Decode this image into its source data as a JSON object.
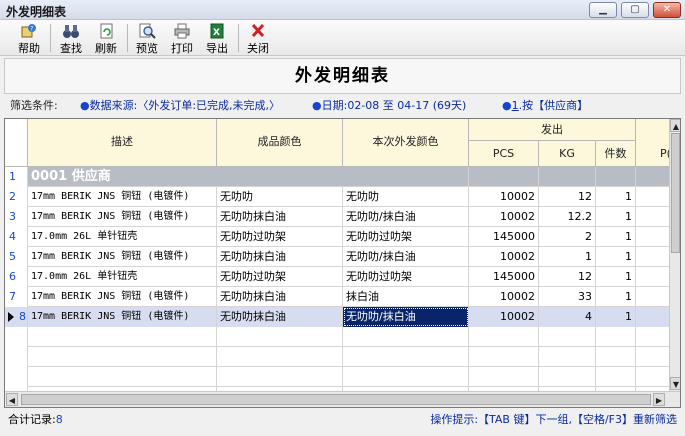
{
  "window": {
    "title": "外发明细表"
  },
  "toolbar": [
    {
      "label": "帮助",
      "icon": "help-icon"
    },
    {
      "label": "查找",
      "icon": "binoculars-icon"
    },
    {
      "label": "刷新",
      "icon": "refresh-icon"
    },
    {
      "label": "预览",
      "icon": "magnifier-icon"
    },
    {
      "label": "打印",
      "icon": "printer-icon"
    },
    {
      "label": "导出",
      "icon": "excel-export-icon"
    },
    {
      "label": "关闭",
      "icon": "close-x-icon"
    }
  ],
  "report": {
    "title": "外发明细表"
  },
  "filter": {
    "label": "筛选条件:",
    "source": "数据来源:〈外发订单:已完成,未完成,〉",
    "date": "日期:02-08 至 04-17 (69天)",
    "group_num": "1",
    "group_text": ".按【供应商】"
  },
  "table": {
    "headers": {
      "desc": "描述",
      "color": "成品颜色",
      "out_color": "本次外发颜色",
      "issued": "发出",
      "pcs": "PCS",
      "kg": "KG",
      "pieces": "件数",
      "extra": "P("
    },
    "group": {
      "rn": "1",
      "text": "0001  供应商"
    },
    "rows": [
      {
        "rn": "2",
        "desc": "17mm BERIK JNS 铜钮 (电镀件)",
        "color": "无叻叻",
        "out_color": "无叻叻",
        "pcs": "10002",
        "kg": "12",
        "pieces": "1"
      },
      {
        "rn": "3",
        "desc": "17mm BERIK JNS 铜钮 (电镀件)",
        "color": "无叻叻抹白油",
        "out_color": "无叻叻/抹白油",
        "pcs": "10002",
        "kg": "12.2",
        "pieces": "1"
      },
      {
        "rn": "4",
        "desc": "17.0mm 26L 单针钮壳",
        "color": "无叻叻过叻架",
        "out_color": "无叻叻过叻架",
        "pcs": "145000",
        "kg": "2",
        "pieces": "1"
      },
      {
        "rn": "5",
        "desc": "17mm BERIK JNS 铜钮 (电镀件)",
        "color": "无叻叻抹白油",
        "out_color": "无叻叻/抹白油",
        "pcs": "10002",
        "kg": "1",
        "pieces": "1"
      },
      {
        "rn": "6",
        "desc": "17.0mm 26L 单针钮壳",
        "color": "无叻叻过叻架",
        "out_color": "无叻叻过叻架",
        "pcs": "145000",
        "kg": "12",
        "pieces": "1"
      },
      {
        "rn": "7",
        "desc": "17mm BERIK JNS 铜钮 (电镀件)",
        "color": "无叻叻抹白油",
        "out_color": "抹白油",
        "pcs": "10002",
        "kg": "33",
        "pieces": "1"
      },
      {
        "rn": "8",
        "desc": "17mm BERIK JNS 铜钮 (电镀件)",
        "color": "无叻叻抹白油",
        "out_color": "无叻叻/抹白油",
        "pcs": "10002",
        "kg": "4",
        "pieces": "1"
      }
    ]
  },
  "status": {
    "count_label": "合计记录:",
    "count": "8",
    "hint": "操作提示:【TAB 键】下一组,【空格/F3】重新筛选"
  }
}
